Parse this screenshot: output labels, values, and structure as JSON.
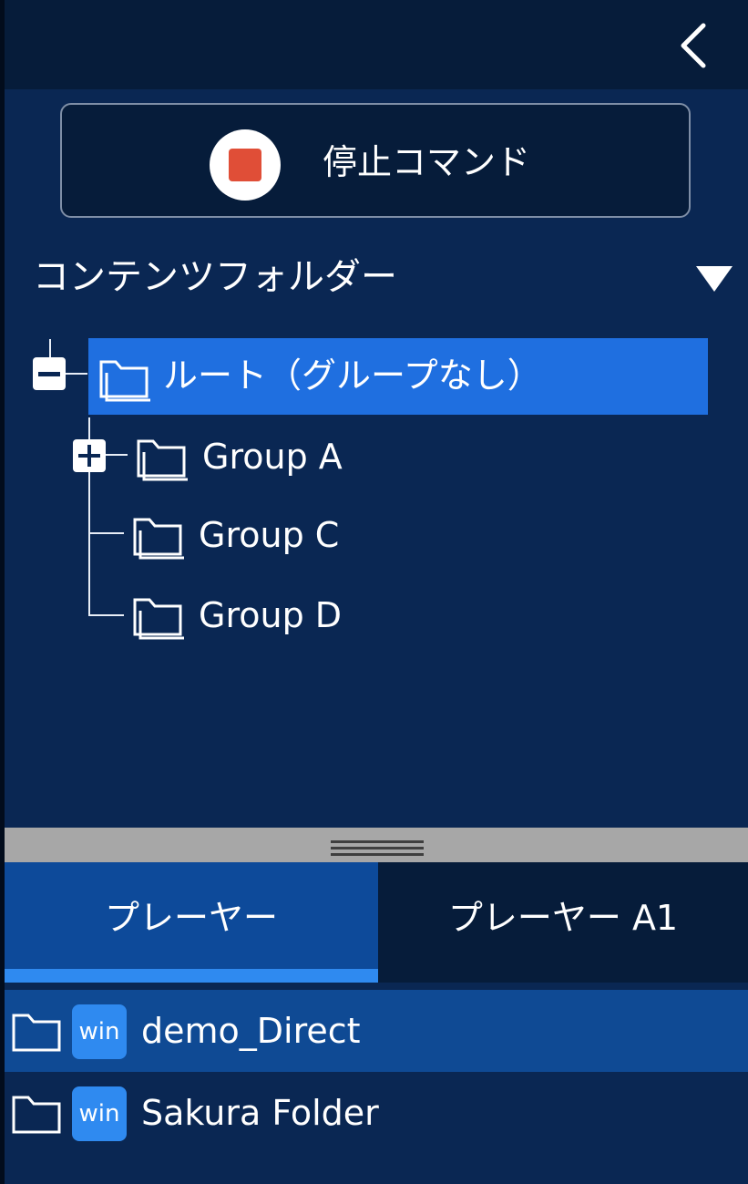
{
  "header": {
    "back_icon": "chevron-left-icon"
  },
  "stop_command": {
    "label": "停止コマンド",
    "icon": "stop-icon",
    "icon_color": "#e04e37"
  },
  "content_folder": {
    "title": "コンテンツフォルダー",
    "toggle_icon": "triangle-down-icon",
    "tree": {
      "root": {
        "label": "ルート（グループなし）",
        "expanded": true,
        "selected": true
      },
      "children": [
        {
          "label": "Group A",
          "expandable": true,
          "expanded": false
        },
        {
          "label": "Group C",
          "expandable": false
        },
        {
          "label": "Group D",
          "expandable": false
        }
      ]
    }
  },
  "tabs": [
    {
      "label": "プレーヤー",
      "active": true
    },
    {
      "label": "プレーヤー A1",
      "active": false
    }
  ],
  "players": [
    {
      "badge": "win",
      "name": "demo_Direct",
      "selected": true
    },
    {
      "badge": "win",
      "name": "Sakura Folder",
      "selected": false
    }
  ],
  "colors": {
    "background": "#0a2753",
    "header": "#061c3a",
    "selection": "#1f6fe0",
    "accent": "#2f8af0",
    "stop_red": "#e04e37"
  }
}
